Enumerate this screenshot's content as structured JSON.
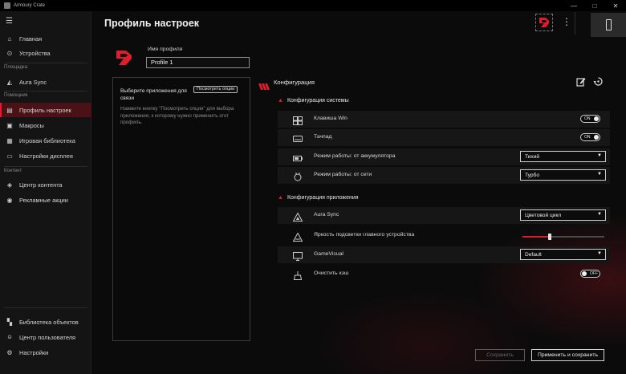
{
  "window": {
    "title": "Armoury Crate",
    "controls": [
      "—",
      "□",
      "✕"
    ]
  },
  "sidebar": {
    "items_top": [
      {
        "label": "Главная",
        "icon": "home-icon",
        "glyph": "⌂"
      },
      {
        "label": "Устройства",
        "icon": "devices-icon",
        "glyph": "⊙"
      }
    ],
    "section_platform": "Площадка",
    "items_platform": [
      {
        "label": "Aura Sync",
        "icon": "aura-icon",
        "glyph": "◭"
      }
    ],
    "section_assistant": "Помощник",
    "items_assistant": [
      {
        "label": "Профиль настроек",
        "icon": "profile-icon",
        "glyph": "▤",
        "active": true
      },
      {
        "label": "Макросы",
        "icon": "macros-icon",
        "glyph": "▣"
      },
      {
        "label": "Игровая библиотека",
        "icon": "library-icon",
        "glyph": "▦"
      },
      {
        "label": "Настройки дисплея",
        "icon": "display-icon",
        "glyph": "▭"
      }
    ],
    "section_content": "Контент",
    "items_content": [
      {
        "label": "Центр контента",
        "icon": "content-center-icon",
        "glyph": "◈"
      },
      {
        "label": "Рекламные акции",
        "icon": "promotions-icon",
        "glyph": "◉"
      }
    ],
    "items_bottom": [
      {
        "label": "Библиотека объектов",
        "icon": "assets-library-icon",
        "glyph": "▚"
      },
      {
        "label": "Центр пользователя",
        "icon": "user-center-icon",
        "glyph": "⍝"
      },
      {
        "label": "Настройки",
        "icon": "settings-icon",
        "glyph": "⚙"
      }
    ]
  },
  "header": {
    "title": "Профиль настроек"
  },
  "profile": {
    "name_label": "Имя профиля",
    "name_value": "Profile 1"
  },
  "apps": {
    "title": "Выберите приложения для связи",
    "view_button": "Посмотреть опции",
    "description": "Нажмите кнопку \"Посмотреть опции\" для выбора приложения, к которому нужно применить этот профиль."
  },
  "config": {
    "title": "Конфигурация",
    "system_section": "Конфигурация системы",
    "system_rows": [
      {
        "label": "Клавиша Win",
        "control": "toggle",
        "value": "ON",
        "on": true
      },
      {
        "label": "Тачпад",
        "control": "toggle",
        "value": "ON",
        "on": true
      },
      {
        "label": "Режим работы: от аккумулятора",
        "control": "select",
        "value": "Тихий"
      },
      {
        "label": "Режим работы: от сети",
        "control": "select",
        "value": "Турбо"
      }
    ],
    "app_section": "Конфигурация приложения",
    "app_rows": [
      {
        "label": "Aura Sync",
        "control": "select",
        "value": "Цветовой цикл"
      },
      {
        "label": "Яркость подсветки главного устройства",
        "control": "slider",
        "level": 0.33
      },
      {
        "label": "GameVisual",
        "control": "select",
        "value": "Default"
      },
      {
        "label": "Очистить кэш",
        "control": "toggle",
        "value": "OFF",
        "on": false
      }
    ]
  },
  "footer": {
    "save_label": "Сохранить",
    "apply_label": "Применить и сохранить"
  },
  "colors": {
    "accent": "#e11d2b",
    "active_bg": "#4a1217",
    "background": "#0b0b0c"
  }
}
